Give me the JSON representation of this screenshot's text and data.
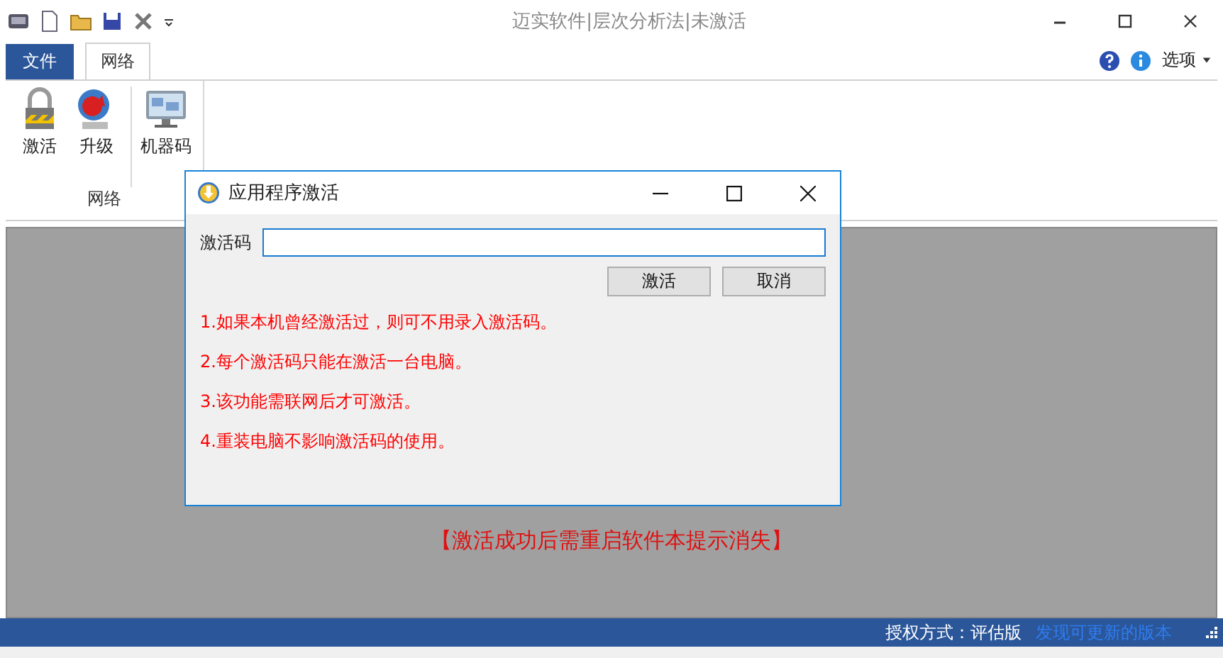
{
  "window": {
    "title": "迈实软件|层次分析法|未激活"
  },
  "ribbon": {
    "tabs": [
      {
        "label": "文件",
        "kind": "file",
        "selected": false
      },
      {
        "label": "网络",
        "kind": "tab",
        "selected": true
      }
    ],
    "options": "选项",
    "groups": [
      {
        "label": "网络",
        "buttons": [
          {
            "label": "激活",
            "kind": "lock"
          },
          {
            "label": "升级",
            "kind": "globe"
          },
          {
            "label": "机器码",
            "kind": "monitor"
          }
        ]
      }
    ]
  },
  "notice": "【激活成功后需重启软件本提示消失】",
  "dialog": {
    "title": "应用程序激活",
    "field_label": "激活码",
    "buttons": [
      "激活",
      "取消"
    ],
    "notes": [
      "1.如果本机曾经激活过，则可不用录入激活码。",
      "2.每个激活码只能在激活一台电脑。",
      "3.该功能需联网后才可激活。",
      "4.重装电脑不影响激活码的使用。"
    ]
  },
  "status_bar": {
    "license": "授权方式：评估版",
    "update_link": "发现可更新的版本"
  }
}
